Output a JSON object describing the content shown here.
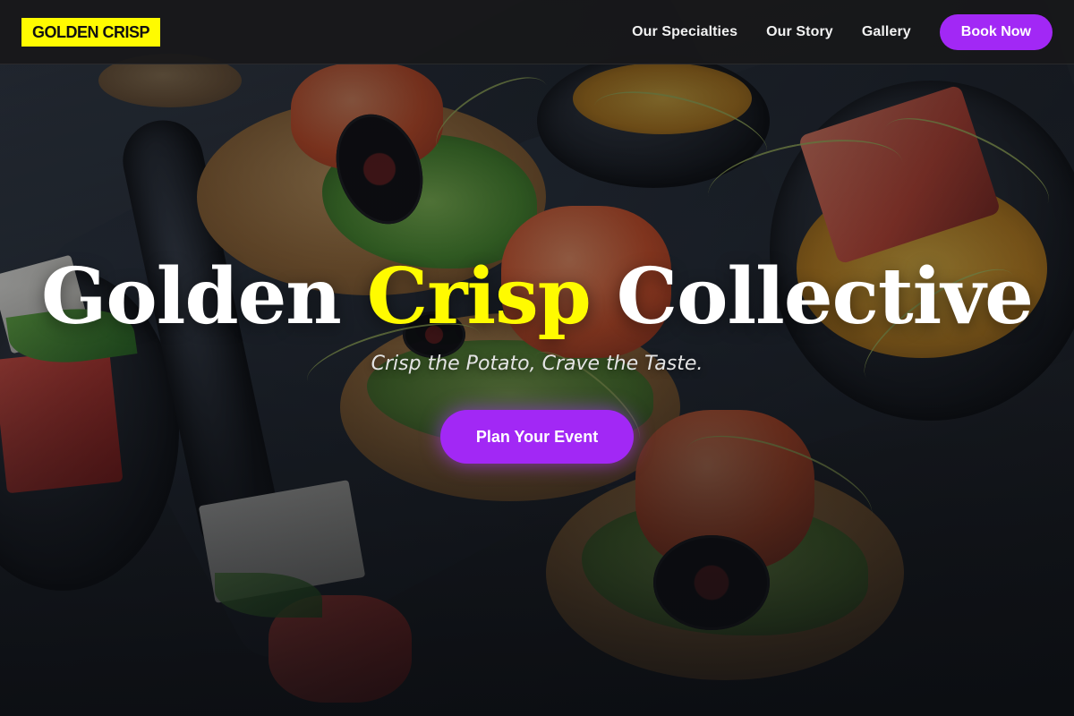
{
  "brand": {
    "logo_text": "GOLDEN CRISP",
    "accent_color": "#fffb00",
    "button_color": "#a228f5"
  },
  "nav": {
    "links": [
      {
        "label": "Our Specialties"
      },
      {
        "label": "Our Story"
      },
      {
        "label": "Gallery"
      }
    ],
    "cta_label": "Book Now"
  },
  "hero": {
    "title_part1": "Golden ",
    "title_accent": "Crisp",
    "title_part2": " Collective",
    "tagline": "Crisp the Potato, Crave the Taste.",
    "cta_label": "Plan Your Event",
    "background_image": "catering platter of canapés with salmon, olives, sprouts and spoons"
  }
}
